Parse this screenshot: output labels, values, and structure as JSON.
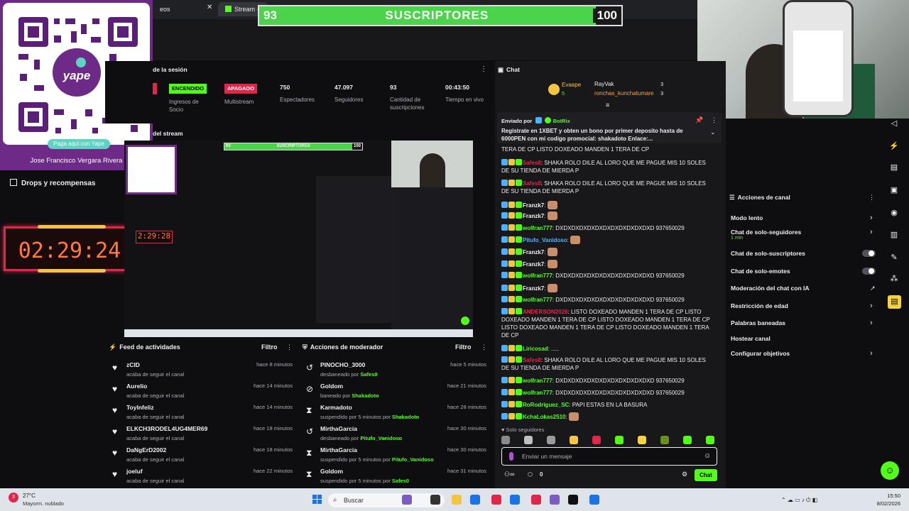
{
  "browser": {
    "tab1_label": "eos",
    "tab2_label": "Stream - Ki",
    "tab_close": "✕"
  },
  "goal": {
    "current": "93",
    "label": "SUSCRIPTORES",
    "target": "100",
    "progress": 0.93
  },
  "qr": {
    "pill": "Paga aquí con Yape",
    "name": "Jose Francisco Vergara Rivera",
    "logo_text": "yape"
  },
  "left_nav": {
    "drops": "Drops y recompensas"
  },
  "timer": {
    "value": "02:29:24"
  },
  "session": {
    "title": "de la sesión",
    "badge_on": "ENCENDIDO",
    "badge_off": "APAGADO",
    "stats": [
      {
        "value": "",
        "label": "Ingresos de Socio"
      },
      {
        "value": "",
        "label": "Multistream"
      },
      {
        "value": "750",
        "label": "Espectadores"
      },
      {
        "value": "47.097",
        "label": "Seguidores"
      },
      {
        "value": "93",
        "label": "Cantidad de suscripciones"
      },
      {
        "value": "00:43:50",
        "label": "Tiempo en vivo"
      }
    ]
  },
  "stream_preview": {
    "title": "del stream",
    "goal_label": "SUSCRIPTORES",
    "goal_current": "93",
    "goal_target": "100",
    "timer": "2:29:28"
  },
  "activity_feed": {
    "title": "Feed de actividades",
    "filter": "Filtro",
    "items": [
      {
        "name": "zCID",
        "action": "acaba de seguir el canal",
        "time": "hace 8 minutos"
      },
      {
        "name": "Aurelio",
        "action": "acaba de seguir el canal",
        "time": "hace 14 minutos"
      },
      {
        "name": "ToyInfeliz",
        "action": "acaba de seguir el canal",
        "time": "hace 14 minutos"
      },
      {
        "name": "ELKCH3RODEL4UG4MER69",
        "action": "acaba de seguir el canal",
        "time": "hace 18 minutos"
      },
      {
        "name": "DaNgErD2002",
        "action": "acaba de seguir el canal",
        "time": "hace 18 minutos"
      },
      {
        "name": "joeluf",
        "action": "acaba de seguir el canal",
        "time": "hace 22 minutos"
      }
    ]
  },
  "mod_actions": {
    "title": "Acciones de moderador",
    "filter": "Filtro",
    "items": [
      {
        "name": "PINOCHO_3000",
        "action": "desbaneado por",
        "by": "Safes0",
        "time": "hace 5 minutos",
        "icon": "undo-icon"
      },
      {
        "name": "Goldom",
        "action": "baneado por",
        "by": "Shakadoto",
        "time": "hace 21 minutos",
        "icon": "ban-icon"
      },
      {
        "name": "Karmadoto",
        "action": "suspendido por 5 minutos por",
        "by": "Shakadoto",
        "time": "hace 28 minutos",
        "icon": "hourglass-icon"
      },
      {
        "name": "MirthaGarcia",
        "action": "desbaneado por",
        "by": "Pitufo_Vanidoso",
        "time": "hace 30 minutos",
        "icon": "undo-icon"
      },
      {
        "name": "MirthaGarcia",
        "action": "suspendido por 5 minutos por",
        "by": "Pitufo_Vanidoso",
        "time": "hace 30 minutos",
        "icon": "hourglass-icon"
      },
      {
        "name": "Goldom",
        "action": "suspendido por 5 minutos por",
        "by": "Safes0",
        "time": "hace 31 minutos",
        "icon": "hourglass-icon"
      }
    ]
  },
  "chat": {
    "title": "Chat",
    "top1": {
      "name": "Evaape",
      "count": "5"
    },
    "top2": {
      "name": "RayVak",
      "count": "3"
    },
    "top3": {
      "name": "ronchas_kunchatumare",
      "count": "3"
    },
    "pinned_by_label": "Enviado por",
    "pinned_by": "BotRix",
    "pinned_text": "Registrate en 1XBET y obten un bono por primer deposito hasta de 6000PEN con mi codigo promocial: shakadoto Enlace:...",
    "messages": [
      {
        "user": "",
        "color": "#efeff1",
        "text": "TERA DE CP  LISTO DOXEADO MANDEN 1 TERA DE CP"
      },
      {
        "user": "Safes0",
        "color": "#e0264a",
        "text": "SHAKA ROLO DILE AL LORO QUE ME PAGUE MIS 10 SOLES DE SU TIENDA DE MIERDA P"
      },
      {
        "user": "Safes0",
        "color": "#e0264a",
        "text": "SHAKA ROLO DILE AL LORO QUE ME PAGUE MIS 10 SOLES DE SU TIENDA DE MIERDA P"
      },
      {
        "user": "Franzk7",
        "color": "#efeff1",
        "text": ""
      },
      {
        "user": "Franzk7",
        "color": "#efeff1",
        "text": ""
      },
      {
        "user": "wolfran777",
        "color": "#53fc18",
        "text": "DXDXDXDXDXDXDXDXDXDXDXDXD 937650029"
      },
      {
        "user": "Pitufo_Vanidoso",
        "color": "#4fb0ff",
        "text": ""
      },
      {
        "user": "Franzk7",
        "color": "#efeff1",
        "text": ""
      },
      {
        "user": "Franzk7",
        "color": "#efeff1",
        "text": ""
      },
      {
        "user": "wolfran777",
        "color": "#53fc18",
        "text": "DXDXDXDXDXDXDXDXDXDXDXDXD 937650029"
      },
      {
        "user": "Franzk7",
        "color": "#efeff1",
        "text": ""
      },
      {
        "user": "wolfran777",
        "color": "#53fc18",
        "text": "DXDXDXDXDXDXDXDXDXDXDXDXD 937650029"
      },
      {
        "user": "ANDERSON2026",
        "color": "#e0264a",
        "text": "LISTO DOXEADO MANDEN 1 TERA DE CP  LISTO DOXEADO MANDEN 1 TERA DE CP  LISTO DOXEADO MANDEN 1 TERA DE CP  LISTO DOXEADO MANDEN 1 TERA DE CP  LISTO DOXEADO MANDEN 1 TERA DE CP"
      },
      {
        "user": "Liricosad",
        "color": "#53fc18",
        "text": "....."
      },
      {
        "user": "Safes0",
        "color": "#e0264a",
        "text": "SHAKA ROLO DILE AL LORO QUE ME PAGUE MIS 10 SOLES DE SU TIENDA DE MIERDA P"
      },
      {
        "user": "wolfran777",
        "color": "#53fc18",
        "text": "DXDXDXDXDXDXDXDXDXDXDXDXD 937650029"
      },
      {
        "user": "wolfran777",
        "color": "#53fc18",
        "text": "DXDXDXDXDXDXDXDXDXDXDXDXD 937650029"
      },
      {
        "user": "RoRodriguez_SC",
        "color": "#53fc18",
        "text": "PAPI ESTAS EN LA BASURA"
      },
      {
        "user": "KchaLokas2510",
        "color": "#53fc18",
        "text": ""
      }
    ],
    "followers_only": "Solo seguidores",
    "input_placeholder": "Enviar un mensaje",
    "viewer_count": "0",
    "send": "Chat"
  },
  "channel_actions": {
    "title": "Acciones de canal",
    "items": [
      {
        "label": "Modo lento",
        "sub": "",
        "control": "chevron"
      },
      {
        "label": "Chat de solo-seguidores",
        "sub": "1 min",
        "control": "chevron"
      },
      {
        "label": "Chat de solo-suscriptores",
        "sub": "",
        "control": "toggle"
      },
      {
        "label": "Chat de solo-emotes",
        "sub": "",
        "control": "toggle"
      },
      {
        "label": "Moderación del chat con IA",
        "sub": "",
        "control": "chart"
      },
      {
        "label": "Restricción de edad",
        "sub": "",
        "control": "chevron"
      },
      {
        "label": "Palabras baneadas",
        "sub": "",
        "control": "chevron"
      },
      {
        "label": "Hostear canal",
        "sub": "",
        "control": "none"
      },
      {
        "label": "Configurar objetivos",
        "sub": "",
        "control": "chevron"
      }
    ]
  },
  "taskbar": {
    "weather_temp": "27°C",
    "weather_desc": "Mayorm. nublado",
    "search": "Buscar",
    "time": "15:50",
    "date": "8/02/2026"
  },
  "colors": {
    "accent": "#53fc18",
    "danger": "#e0264a",
    "timer": "#ff7b3a",
    "purple": "#6d2a87"
  }
}
